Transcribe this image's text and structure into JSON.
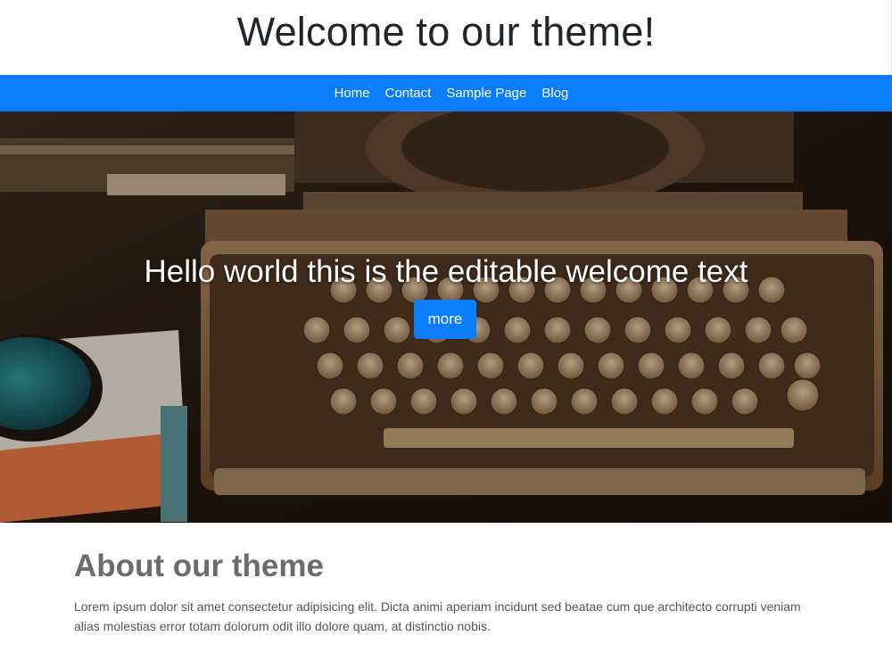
{
  "header": {
    "site_title": "Welcome to our theme!"
  },
  "nav": {
    "items": [
      {
        "label": "Home"
      },
      {
        "label": "Contact"
      },
      {
        "label": "Sample Page"
      },
      {
        "label": "Blog"
      }
    ],
    "background_color": "#0b7dfb"
  },
  "hero": {
    "title": "Hello world this is the editable welcome text",
    "button_label": "more",
    "image_subject": "vintage typewriter"
  },
  "about": {
    "title": "About our theme",
    "text": "Lorem ipsum dolor sit amet consectetur adipisicing elit. Dicta animi aperiam incidunt sed beatae cum que architecto corrupti veniam alias molestias error totam dolorum odit illo dolore quam, at distinctio nobis."
  },
  "colors": {
    "accent": "#0b7dfb",
    "title_text": "#212529",
    "about_title": "#6c6c6c",
    "body_text": "#555555"
  }
}
